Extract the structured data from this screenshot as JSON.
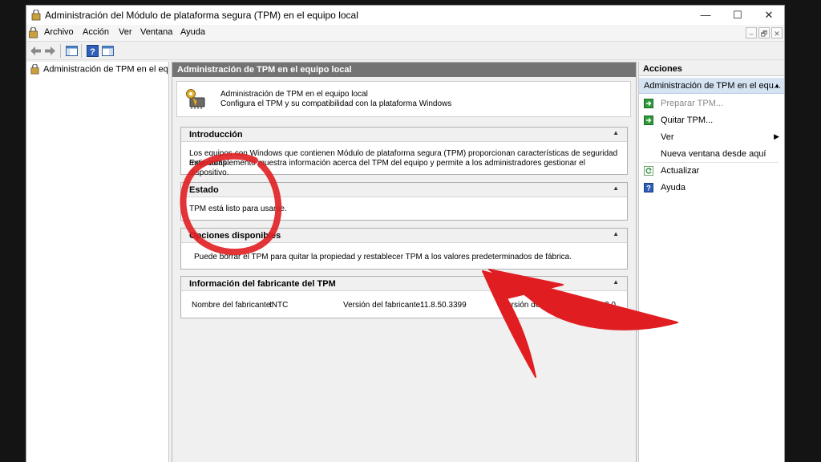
{
  "window": {
    "title": "Administración del Módulo de plataforma segura (TPM) en el equipo local",
    "minimize_glyph": "—",
    "maximize_glyph": "☐",
    "close_glyph": "✕"
  },
  "menu": {
    "items": [
      "Archivo",
      "Acción",
      "Ver",
      "Ventana",
      "Ayuda"
    ],
    "mdi_minimize": "–",
    "mdi_restore": "🗗",
    "mdi_close": "✕"
  },
  "toolbar": {
    "icons": [
      "back-arrow-icon",
      "forward-arrow-icon",
      "show-hide-console-tree-icon",
      "help-icon",
      "properties-icon"
    ]
  },
  "tree": {
    "item_label": "Administración de TPM en el equipo local"
  },
  "center": {
    "header": "Administración de TPM en el equipo local",
    "intro_line1": "Administración de TPM en el equipo local",
    "intro_line2": "Configura el TPM y su compatibilidad con la plataforma Windows",
    "sections": {
      "introduccion": {
        "title": "Introducción",
        "line1": "Los equipos con Windows que contienen Módulo de plataforma segura (TPM) proporcionan características de seguridad mejoradas.",
        "line2": "Este complemento muestra información acerca del TPM del equipo y permite a los administradores gestionar el dispositivo."
      },
      "estado": {
        "title": "Estado",
        "text": "TPM está listo para usarse."
      },
      "opciones": {
        "title": "Opciones disponibles",
        "text": "Puede borrar el TPM para quitar la propiedad y restablecer TPM a los valores predeterminados de fábrica."
      },
      "fabricante": {
        "title": "Información del fabricante del TPM",
        "name_label": "Nombre del fabricante:",
        "name_value": "INTC",
        "version_label": "Versión del fabricante:",
        "version_value": "11.8.50.3399",
        "spec_label": "Versión de la especificación:",
        "spec_value": "2.0"
      }
    }
  },
  "actions": {
    "header": "Acciones",
    "subheader": "Administración de TPM en el equ...",
    "items": [
      {
        "label": "Preparar TPM...",
        "icon": "green-arrow-icon",
        "enabled": false
      },
      {
        "label": "Quitar TPM...",
        "icon": "green-arrow-icon",
        "enabled": true
      },
      {
        "label": "Ver",
        "icon": "",
        "enabled": true
      },
      {
        "label": "Nueva ventana desde aquí",
        "icon": "",
        "enabled": true
      },
      {
        "label": "Actualizar",
        "icon": "refresh-icon",
        "enabled": true
      },
      {
        "label": "Ayuda",
        "icon": "help-icon",
        "enabled": true
      }
    ]
  },
  "colors": {
    "header_bg": "#737373",
    "action_selected_bg": "#d5e3f2",
    "annotation_red": "#e01e22"
  }
}
